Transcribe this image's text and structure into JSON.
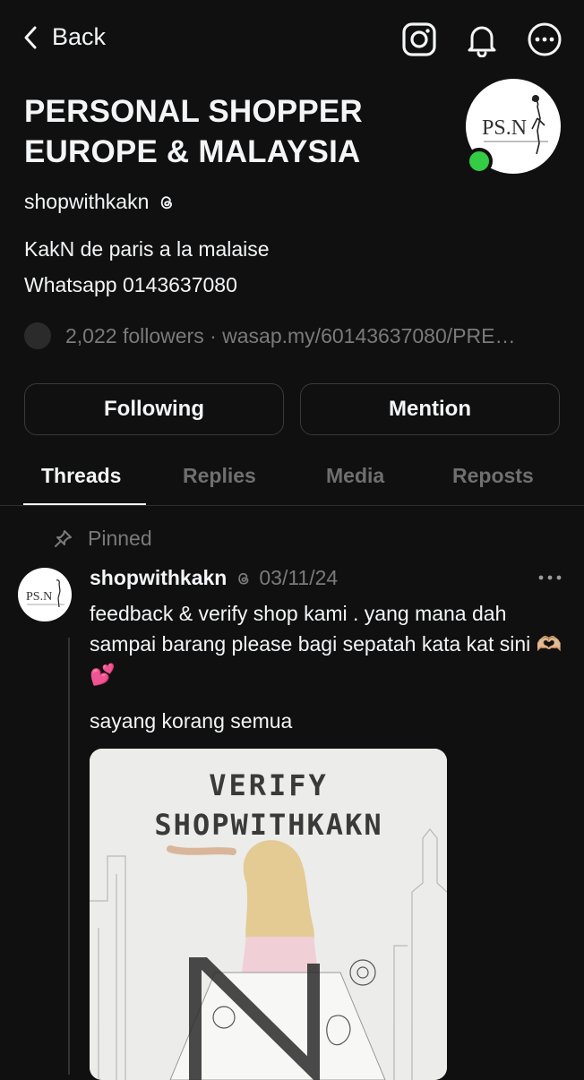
{
  "topbar": {
    "back_label": "Back",
    "icons": [
      "instagram-icon",
      "bell-icon",
      "more-icon"
    ]
  },
  "profile": {
    "title_line1": "PERSONAL SHOPPER",
    "title_line2": "EUROPE & MALAYSIA",
    "handle": "shopwithkakn",
    "bio_line1": "KakN de paris a la malaise",
    "bio_line2": "Whatsapp 0143637080",
    "followers": "2,022 followers · wasap.my/60143637080/PRE…",
    "avatar_text": "PS.N",
    "online": true
  },
  "actions": {
    "following_label": "Following",
    "mention_label": "Mention"
  },
  "tabs": [
    {
      "label": "Threads",
      "active": true
    },
    {
      "label": "Replies",
      "active": false
    },
    {
      "label": "Media",
      "active": false
    },
    {
      "label": "Reposts",
      "active": false
    }
  ],
  "post": {
    "pinned_label": "Pinned",
    "author": "shopwithkakn",
    "date": "03/11/24",
    "text": "feedback & verify shop kami . yang mana dah sampai barang please bagi sepatah kata kat sini 🫶🏼💕",
    "text2": "sayang korang semua",
    "image": {
      "line1": "VERIFY",
      "line2": "SHOPWITHKAKN"
    }
  },
  "colors": {
    "background": "#101010",
    "text": "#f3f5f7",
    "muted": "#7a7a7a",
    "online": "#33cc44"
  }
}
